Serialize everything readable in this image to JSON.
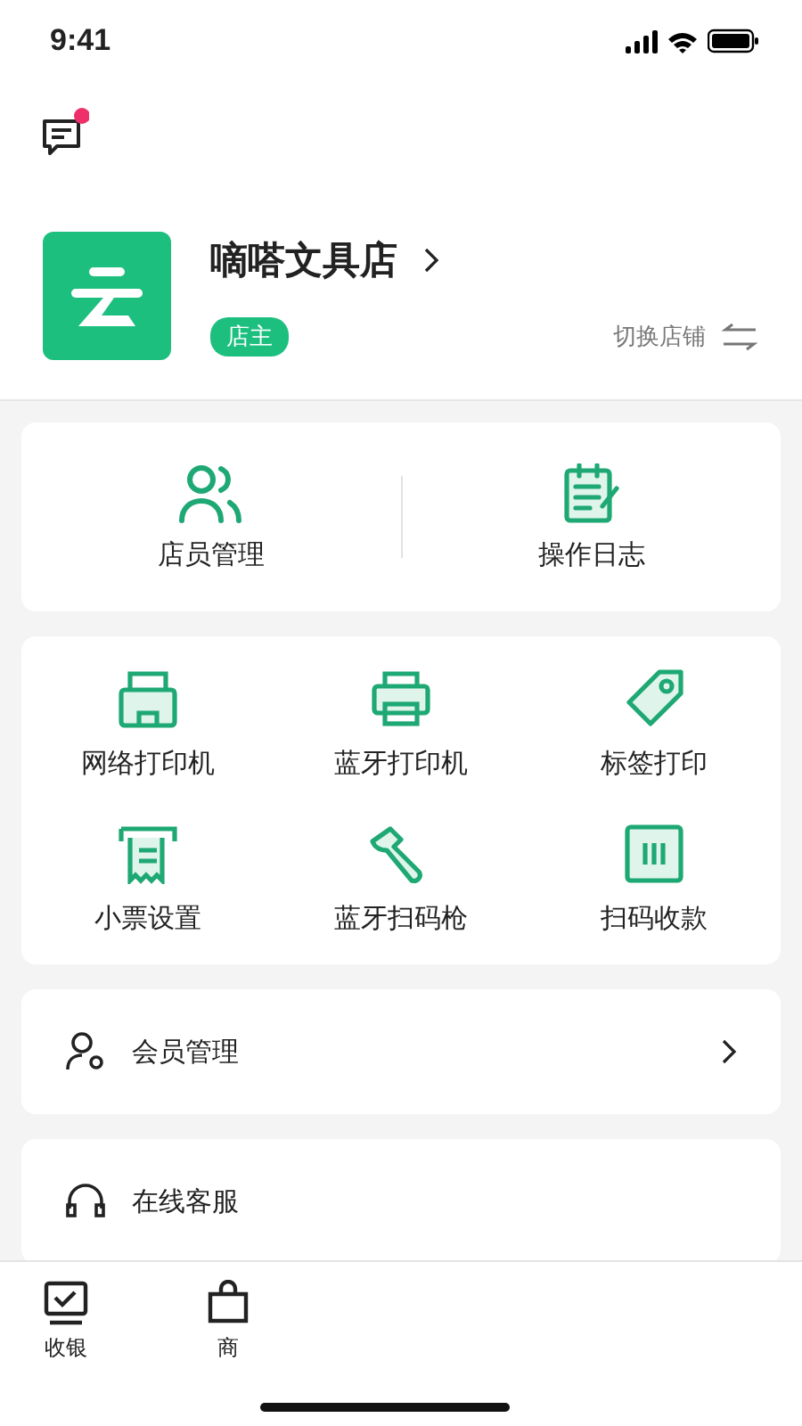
{
  "status_bar": {
    "time": "9:41"
  },
  "messages": {
    "unread": true
  },
  "store": {
    "name": "嘀嗒文具店",
    "role": "店主",
    "switch_label": "切换店铺"
  },
  "management": [
    {
      "label": "店员管理"
    },
    {
      "label": "操作日志"
    }
  ],
  "devices": [
    {
      "label": "网络打印机"
    },
    {
      "label": "蓝牙打印机"
    },
    {
      "label": "标签打印"
    },
    {
      "label": "小票设置"
    },
    {
      "label": "蓝牙扫码枪"
    },
    {
      "label": "扫码收款"
    }
  ],
  "menu_rows": [
    {
      "label": "会员管理",
      "chevron": true
    },
    {
      "label": "在线客服",
      "chevron": false
    }
  ],
  "tab_bar": [
    {
      "label": "收银",
      "selected": false
    },
    {
      "label": "商",
      "selected": false
    }
  ]
}
